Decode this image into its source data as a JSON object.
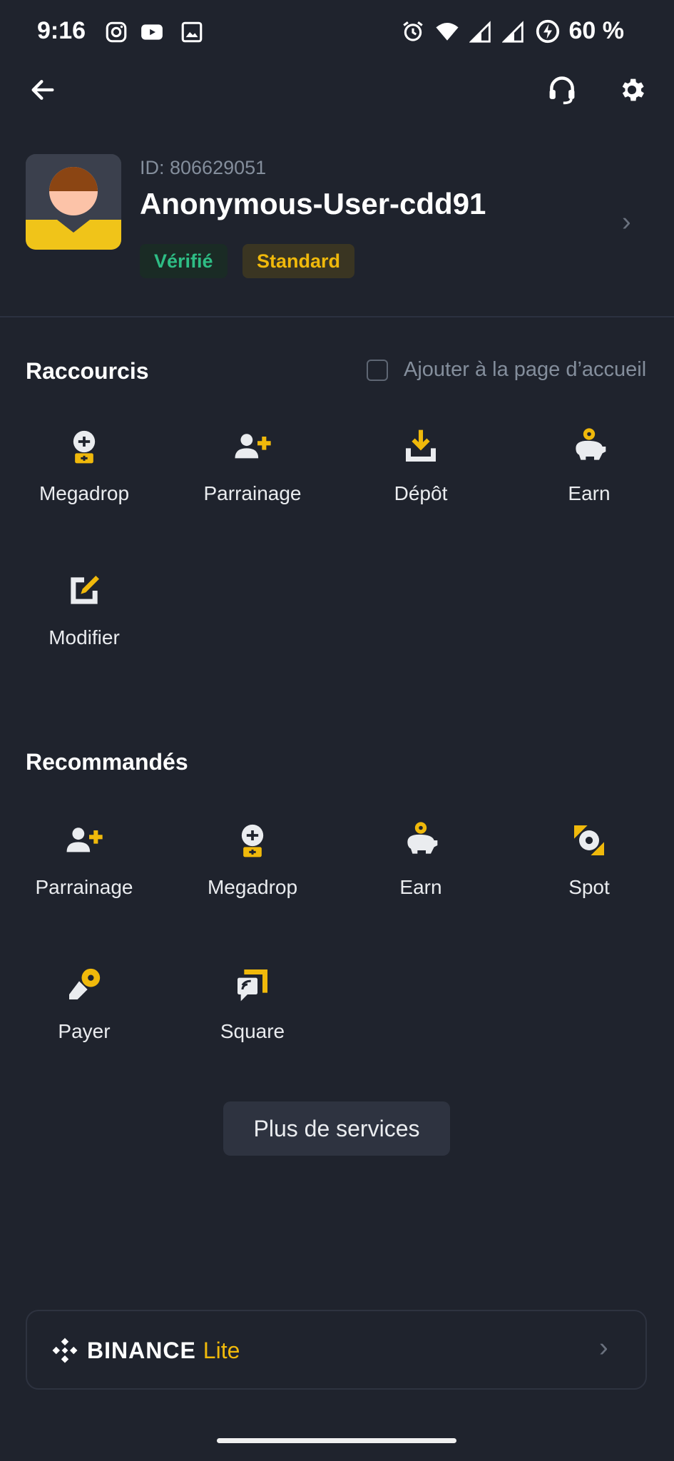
{
  "status_bar": {
    "time": "9:16",
    "battery": "60 %",
    "icons": [
      "instagram-icon",
      "youtube-icon",
      "gallery-icon",
      "alarm-icon",
      "wifi-icon",
      "signal-icon",
      "signal-icon",
      "battery-saver-icon"
    ]
  },
  "profile": {
    "id_label": "ID: 806629051",
    "username": "Anonymous-User-cdd91",
    "badge_verified": "Vérifié",
    "badge_tier": "Standard"
  },
  "shortcuts": {
    "title": "Raccourcis",
    "add_to_home_label": "Ajouter à la page d’accueil",
    "items": [
      {
        "label": "Megadrop",
        "icon": "megadrop-icon"
      },
      {
        "label": "Parrainage",
        "icon": "referral-icon"
      },
      {
        "label": "Dépôt",
        "icon": "deposit-icon"
      },
      {
        "label": "Earn",
        "icon": "earn-icon"
      },
      {
        "label": "Modifier",
        "icon": "edit-icon"
      }
    ]
  },
  "recommended": {
    "title": "Recommandés",
    "items": [
      {
        "label": "Parrainage",
        "icon": "referral-icon"
      },
      {
        "label": "Megadrop",
        "icon": "megadrop-icon"
      },
      {
        "label": "Earn",
        "icon": "earn-icon"
      },
      {
        "label": "Spot",
        "icon": "spot-icon"
      },
      {
        "label": "Payer",
        "icon": "pay-icon"
      },
      {
        "label": "Square",
        "icon": "square-icon"
      }
    ]
  },
  "more_services_label": "Plus de services",
  "lite": {
    "brand": "BINANCE",
    "suffix": "Lite"
  },
  "colors": {
    "background": "#1f232d",
    "accent": "#f0b90b",
    "success": "#2ebd85"
  }
}
